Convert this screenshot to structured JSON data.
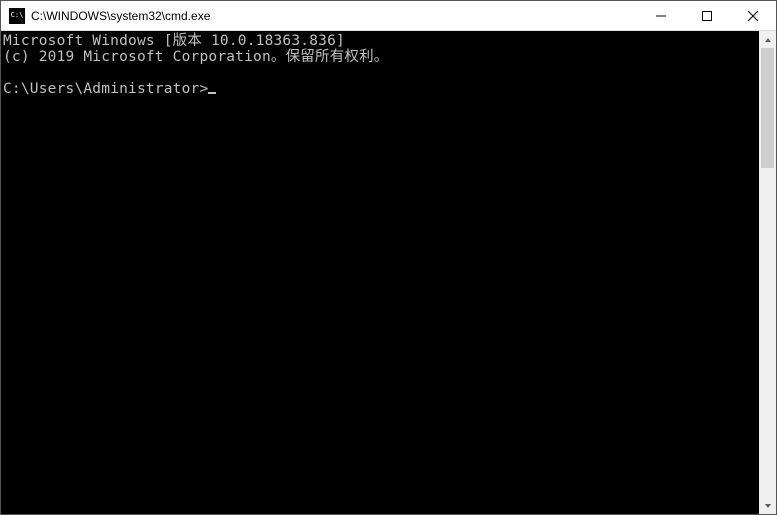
{
  "window": {
    "title": "C:\\WINDOWS\\system32\\cmd.exe"
  },
  "terminal": {
    "line1": "Microsoft Windows [版本 10.0.18363.836]",
    "line2": "(c) 2019 Microsoft Corporation。保留所有权利。",
    "prompt": "C:\\Users\\Administrator>"
  }
}
